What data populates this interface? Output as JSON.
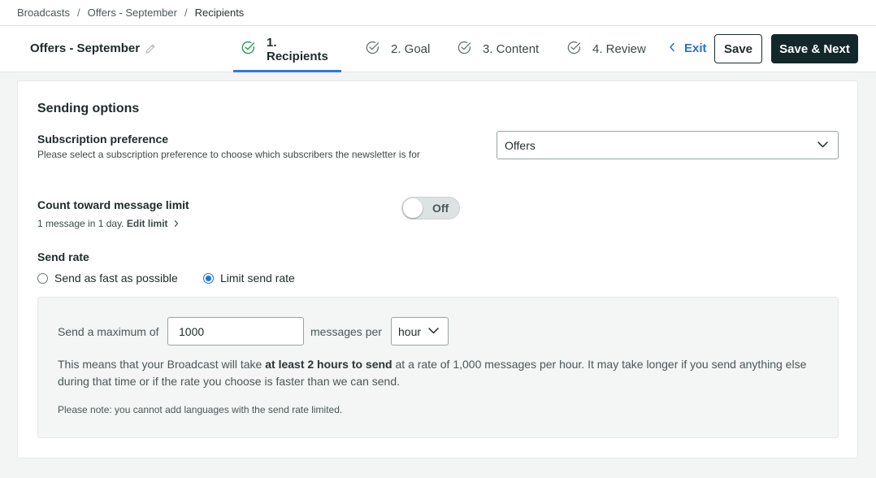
{
  "breadcrumb": {
    "items": [
      "Broadcasts",
      "Offers - September"
    ],
    "current": "Recipients",
    "separator": "/"
  },
  "header": {
    "broadcast_name": "Offers - September",
    "steps": [
      {
        "label": "1. Recipients",
        "active": true
      },
      {
        "label": "2. Goal",
        "active": false
      },
      {
        "label": "3. Content",
        "active": false
      },
      {
        "label": "4. Review",
        "active": false
      }
    ],
    "exit_label": "Exit",
    "save_label": "Save",
    "save_next_label": "Save & Next"
  },
  "sending_options": {
    "title": "Sending options",
    "subscription": {
      "label": "Subscription preference",
      "help": "Please select a subscription preference to choose which subscribers the newsletter is for",
      "selected": "Offers"
    },
    "message_limit": {
      "label": "Count toward message limit",
      "help": "1 message in 1 day.",
      "edit_label": "Edit limit",
      "toggle_state": "Off"
    },
    "send_rate": {
      "label": "Send rate",
      "options": [
        "Send as fast as possible",
        "Limit send rate"
      ],
      "selected_index": 1,
      "prefix": "Send a maximum of",
      "value": "1000",
      "middle": "messages per",
      "unit": "hour",
      "explain_pre": "This means that your Broadcast will take ",
      "explain_bold": "at least 2 hours to send",
      "explain_post": " at a rate of 1,000 messages per hour. It may take longer if you send anything else during that time or if the rate you choose is faster than we can send.",
      "note": "Please note: you cannot add languages with the send rate limited."
    }
  },
  "colors": {
    "accent": "#3378d8",
    "link": "#2a6fcf",
    "primary_button": "#13282a",
    "success_check": "#2e9e5b"
  }
}
